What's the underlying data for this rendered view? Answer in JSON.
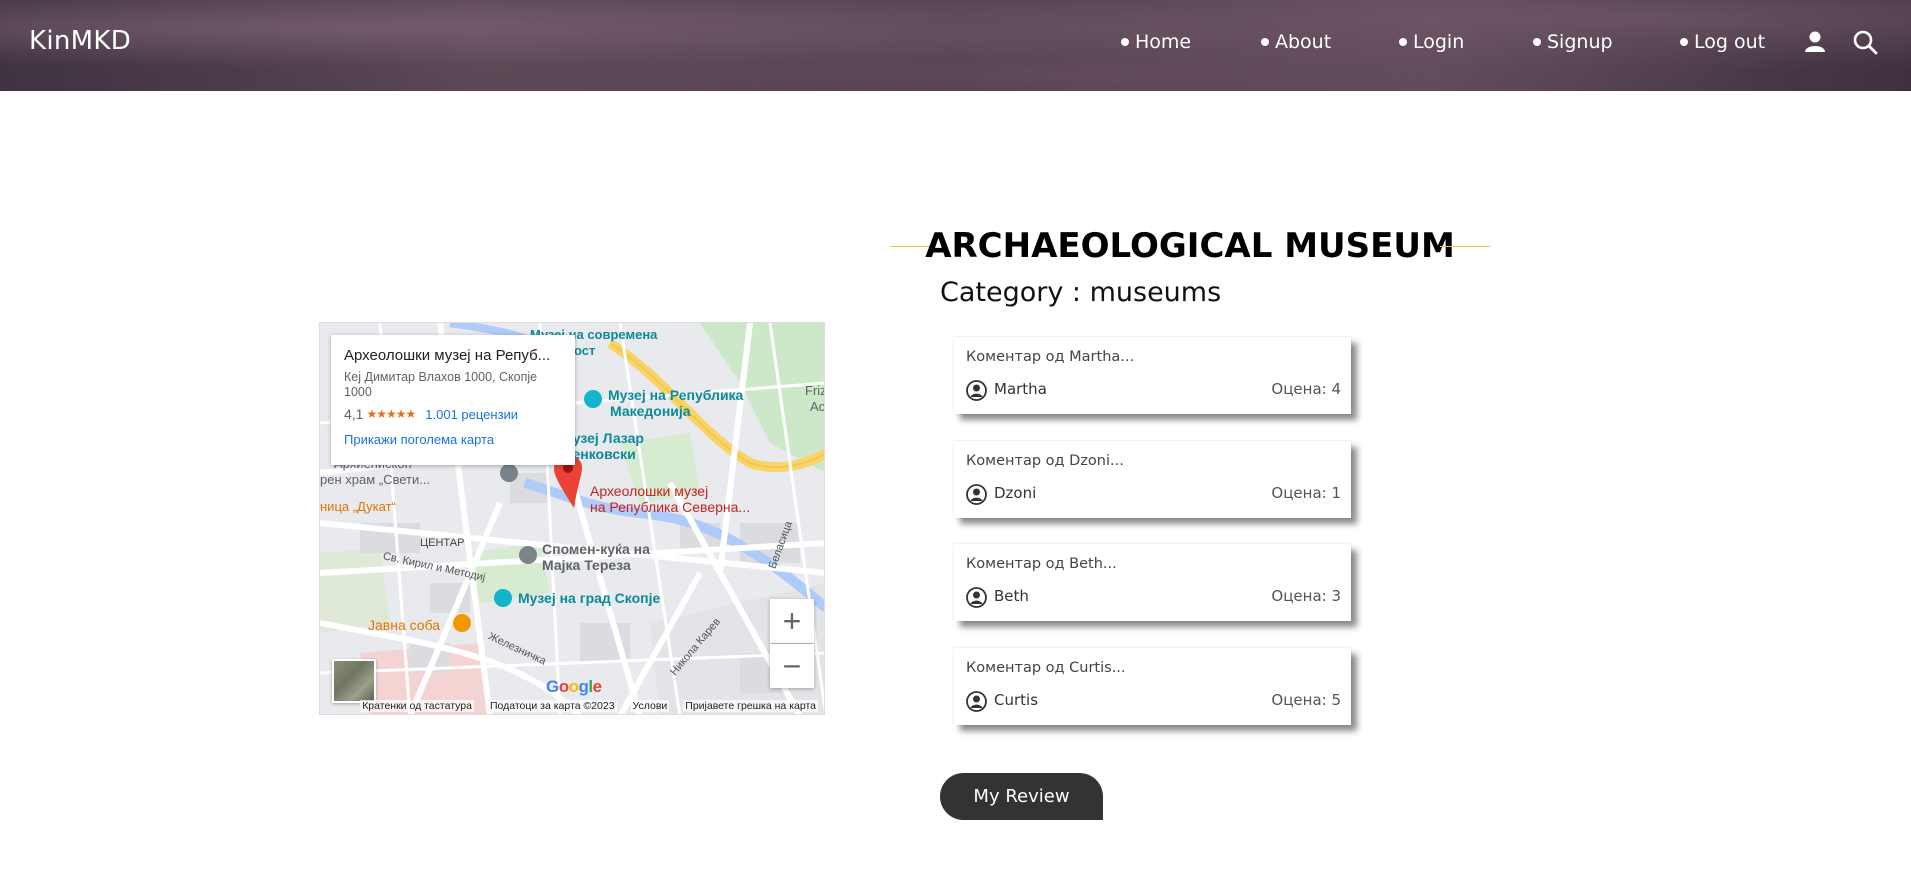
{
  "header": {
    "brand": "KinMKD",
    "nav": [
      "Home",
      "About",
      "Login",
      "Signup",
      "Log out"
    ],
    "icons": [
      "user-icon",
      "search-icon"
    ]
  },
  "place": {
    "title": "ARCHAEOLOGICAL MUSEUM",
    "category": "Category : museums"
  },
  "map": {
    "card_title": "Археолошки музеј на Репуб...",
    "card_address": "Кеј Димитар Влахов 1000, Скопје 1000",
    "rating": "4,1",
    "stars": "★★★★★",
    "reviews": "1.001 рецензии",
    "bigger_map": "Прикажи поголема карта",
    "zoom_in": "+",
    "zoom_out": "−",
    "logo": "Google",
    "footer": [
      "Кратенки од тастатура",
      "Податоци за карта ©2023",
      "Услови",
      "Пријавете грешка на карта"
    ],
    "labels": {
      "museum_mk_1": "Музеј на Република",
      "museum_mk_2": "Македонија",
      "museum_contemporary": "Музеј на современа",
      "museum_contemporary_2": "ост",
      "lazar_1": "- музеј Лазар",
      "lazar_2": "ненковски",
      "pin_1": "Археолошки музеј",
      "pin_2": "на Република Северна...",
      "church_1": "Архиепископ",
      "church_2": "рен храм „Свети...",
      "dukat": "ница „Дукат“",
      "center": "ЦЕНТАР",
      "teresa_1": "Спомен-куќа на",
      "teresa_2": "Мајка Тереза",
      "museum_city": "Музеј на град Скопје",
      "javna": "Јавна соба",
      "street_kiril": "Св. Кирил и Методиј",
      "street_zel": "Железничка",
      "street_karev": "Никола Карев",
      "street_belasica": "Беласица",
      "friz_1": "Friz",
      "friz_2": "Ac"
    }
  },
  "reviews": [
    {
      "comment": "Коментар од Martha...",
      "user": "Martha",
      "score": "Оцена: 4"
    },
    {
      "comment": "Коментар од Dzoni...",
      "user": "Dzoni",
      "score": "Оцена: 1"
    },
    {
      "comment": "Коментар од Beth...",
      "user": "Beth",
      "score": "Оцена: 3"
    },
    {
      "comment": "Коментар од Curtis...",
      "user": "Curtis",
      "score": "Оцена: 5"
    }
  ],
  "actions": {
    "my_review": "My Review"
  },
  "colors": {
    "accent_line": "#f0c24b",
    "button_bg": "#333333",
    "pin": "#ea4335",
    "river": "#aecbfa"
  }
}
